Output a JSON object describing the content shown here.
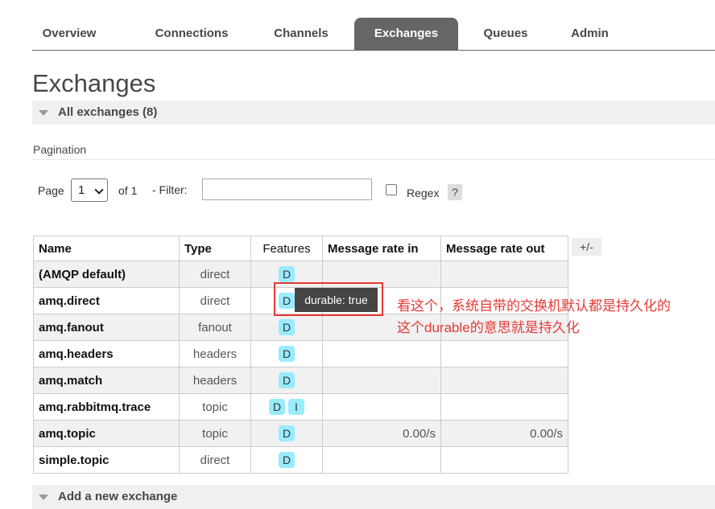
{
  "tabs": [
    {
      "label": "Overview",
      "active": false
    },
    {
      "label": "Connections",
      "active": false
    },
    {
      "label": "Channels",
      "active": false
    },
    {
      "label": "Exchanges",
      "active": true
    },
    {
      "label": "Queues",
      "active": false
    },
    {
      "label": "Admin",
      "active": false
    }
  ],
  "page_title": "Exchanges",
  "section_all": "All exchanges (8)",
  "pagination": {
    "label": "Pagination",
    "page_label": "Page",
    "page_value": "1",
    "of_label": "of 1",
    "filter_label": "- Filter:",
    "filter_value": "",
    "regex_label": "Regex",
    "regex_checked": false,
    "help": "?"
  },
  "table": {
    "headers": [
      "Name",
      "Type",
      "Features",
      "Message rate in",
      "Message rate out"
    ],
    "column_toggle": "+/-",
    "rows": [
      {
        "name": "(AMQP default)",
        "type": "direct",
        "features": [
          "D"
        ],
        "rate_in": "",
        "rate_out": ""
      },
      {
        "name": "amq.direct",
        "type": "direct",
        "features": [
          "D"
        ],
        "rate_in": "",
        "rate_out": ""
      },
      {
        "name": "amq.fanout",
        "type": "fanout",
        "features": [
          "D"
        ],
        "rate_in": "",
        "rate_out": ""
      },
      {
        "name": "amq.headers",
        "type": "headers",
        "features": [
          "D"
        ],
        "rate_in": "",
        "rate_out": ""
      },
      {
        "name": "amq.match",
        "type": "headers",
        "features": [
          "D"
        ],
        "rate_in": "",
        "rate_out": ""
      },
      {
        "name": "amq.rabbitmq.trace",
        "type": "topic",
        "features": [
          "D",
          "I"
        ],
        "rate_in": "",
        "rate_out": ""
      },
      {
        "name": "amq.topic",
        "type": "topic",
        "features": [
          "D"
        ],
        "rate_in": "0.00/s",
        "rate_out": "0.00/s"
      },
      {
        "name": "simple.topic",
        "type": "direct",
        "features": [
          "D"
        ],
        "rate_in": "",
        "rate_out": ""
      }
    ]
  },
  "tooltip": "durable: true",
  "annotation": {
    "line1": "看这个，系统自带的交换机默认都是持久化的",
    "line2": "这个durable的意思就是持久化"
  },
  "section_add": "Add a new exchange",
  "colors": {
    "tab_active_bg": "#666666",
    "badge_bg": "#99ebff",
    "annotation": "#e53935",
    "row_alt": "#f1f1f1"
  }
}
